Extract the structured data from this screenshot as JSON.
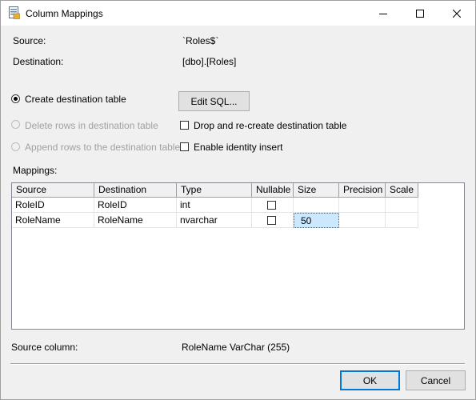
{
  "window": {
    "title": "Column Mappings"
  },
  "source": {
    "label": "Source:",
    "value": "`Roles$`"
  },
  "destination": {
    "label": "Destination:",
    "value": "[dbo].[Roles]"
  },
  "options": {
    "create_table": "Create destination table",
    "delete_rows": "Delete rows in destination table",
    "append_rows": "Append rows to the destination table",
    "edit_sql": "Edit SQL...",
    "drop_recreate": "Drop and re-create destination table",
    "identity_insert": "Enable identity insert"
  },
  "mappings": {
    "label": "Mappings:",
    "columns": [
      "Source",
      "Destination",
      "Type",
      "Nullable",
      "Size",
      "Precision",
      "Scale"
    ],
    "rows": [
      {
        "source": "RoleID",
        "destination": "RoleID",
        "type": "int",
        "nullable": false,
        "size": "",
        "precision": "",
        "scale": ""
      },
      {
        "source": "RoleName",
        "destination": "RoleName",
        "type": "nvarchar",
        "nullable": false,
        "size": "50",
        "precision": "",
        "scale": ""
      }
    ]
  },
  "source_column": {
    "label": "Source column:",
    "value": "RoleName VarChar (255)"
  },
  "buttons": {
    "ok": "OK",
    "cancel": "Cancel"
  },
  "colors": {
    "accent": "#0078d7",
    "selection": "#cce8ff"
  }
}
